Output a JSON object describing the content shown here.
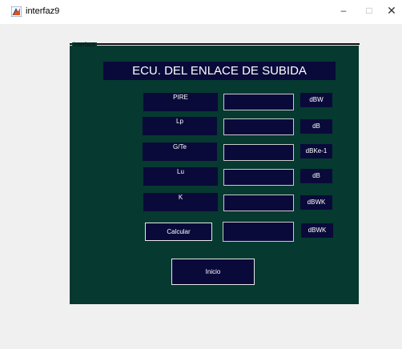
{
  "window": {
    "title": "interfaz9",
    "minimize_glyph": "–",
    "maximize_glyph": "□",
    "close_glyph": "✕"
  },
  "panel": {
    "legend": "interfaz9"
  },
  "heading": "ECU. DEL ENLACE DE SUBIDA",
  "rows": [
    {
      "label": "PIRE",
      "value": "",
      "unit": "dBW"
    },
    {
      "label": "Lp",
      "value": "",
      "unit": "dB"
    },
    {
      "label": "G/Te",
      "value": "",
      "unit": "dBKe-1"
    },
    {
      "label": "Lu",
      "value": "",
      "unit": "dB"
    },
    {
      "label": "K",
      "value": "",
      "unit": "dBWK"
    }
  ],
  "result": {
    "value": "",
    "unit": "dBWK"
  },
  "buttons": {
    "calcular": "Calcular",
    "inicio": "Inicio"
  },
  "colors": {
    "panel_bg": "#063930",
    "control_bg": "#0a0a3a",
    "window_bg": "#f0f0f0"
  }
}
